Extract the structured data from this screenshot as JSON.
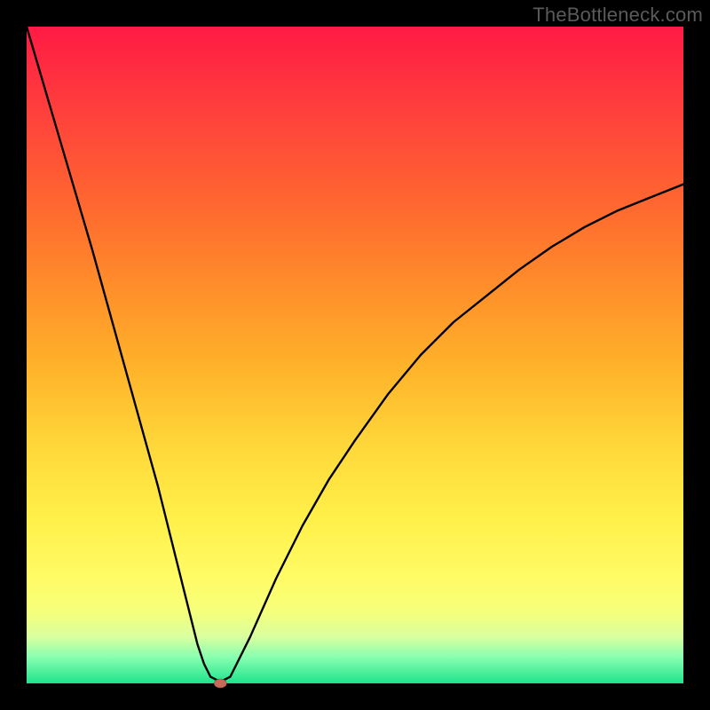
{
  "watermark": "TheBottleneck.com",
  "chart_data": {
    "type": "line",
    "title": "",
    "xlabel": "",
    "ylabel": "",
    "xlim": [
      0,
      100
    ],
    "ylim": [
      0,
      100
    ],
    "grid": false,
    "legend": false,
    "series": [
      {
        "name": "curve",
        "x": [
          0,
          5,
          10,
          15,
          20,
          24,
          26,
          27,
          28,
          29,
          30,
          31,
          34,
          38,
          42,
          46,
          50,
          55,
          60,
          65,
          70,
          75,
          80,
          85,
          90,
          95,
          100
        ],
        "y": [
          100,
          83,
          66,
          48,
          30,
          14,
          6,
          3,
          1,
          0.5,
          0.5,
          1,
          7,
          16,
          24,
          31,
          37,
          44,
          50,
          55,
          59,
          63,
          66.5,
          69.5,
          72,
          74,
          76
        ]
      }
    ],
    "marker": {
      "x": 29.5,
      "y": 0,
      "color": "#c76a5a",
      "rx": 7,
      "ry": 5
    },
    "colors": {
      "curve_stroke": "#000000",
      "background_top": "#ff1a44",
      "background_bottom": "#1fe38d",
      "frame": "#000000"
    }
  }
}
